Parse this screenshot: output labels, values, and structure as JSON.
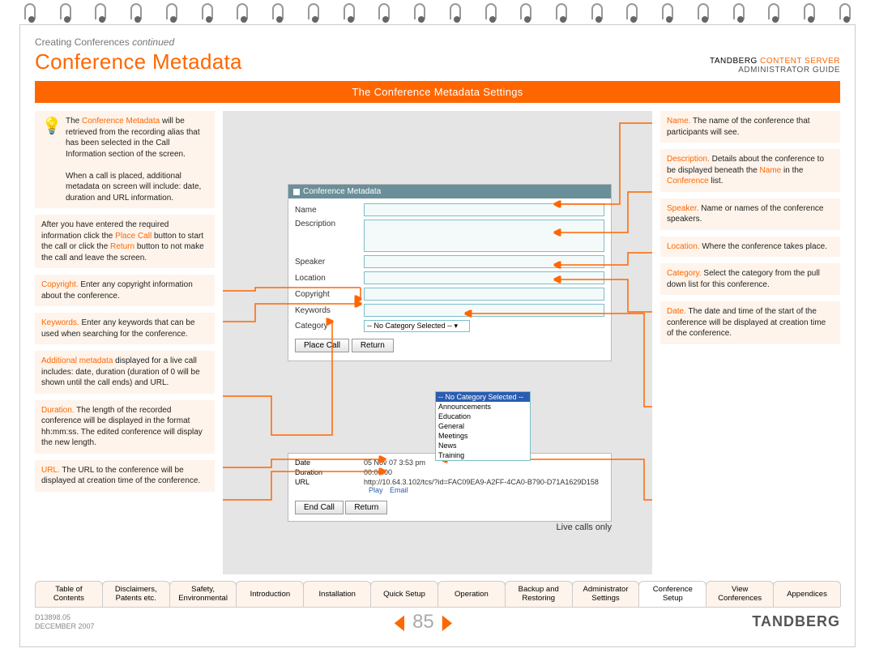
{
  "breadcrumb": {
    "main": "Creating Conferences",
    "sub": "continued"
  },
  "page_title": "Conference Metadata",
  "brand": {
    "name": "TANDBERG",
    "product": "CONTENT SERVER",
    "subtitle": "ADMINISTRATOR GUIDE"
  },
  "banner": "The Conference Metadata Settings",
  "left_cards": [
    {
      "bulb": true,
      "html": "The |Conference Metadata| will be retrieved from the recording alias that has been selected in the Call Information section of the screen.\nWhen a call is placed, additional metadata on screen will include: date, duration and URL information."
    },
    {
      "html": "After you have entered the required information click the |Place Call| button to start the call or click the |Return| button to not make the call and leave the screen."
    },
    {
      "html": "|Copyright.| Enter any copyright information about the conference."
    },
    {
      "html": "|Keywords.| Enter any keywords that can be used when searching for the conference."
    },
    {
      "html": "|Additional metadata| displayed for a live call includes: date, duration (duration of 0 will be shown until the call ends) and URL."
    },
    {
      "html": "|Duration.| The length of the recorded conference will be displayed in the format hh:mm:ss. The edited conference will display the new length."
    },
    {
      "html": "|URL.| The URL to the conference will be displayed at creation time of the conference."
    }
  ],
  "right_cards": [
    {
      "html": "|Name.| The name of the conference that participants will see."
    },
    {
      "html": "|Description.| Details about the conference to be displayed beneath the |Name| in the |Conference| list."
    },
    {
      "html": "|Speaker.| Name or names of the conference speakers."
    },
    {
      "html": "|Location.| Where the conference takes place."
    },
    {
      "html": "|Category.| Select the category from the pull down list for this conference."
    },
    {
      "html": "|Date.| The date and time of the start of the conference will be displayed at creation time of the conference."
    }
  ],
  "form": {
    "title": "Conference Metadata",
    "fields": {
      "name": "Name",
      "description": "Description",
      "speaker": "Speaker",
      "location": "Location",
      "copyright": "Copyright",
      "keywords": "Keywords",
      "category": "Category"
    },
    "category_selected": "-- No Category Selected --",
    "category_options": [
      "-- No Category Selected --",
      "Announcements",
      "Education",
      "General",
      "Meetings",
      "News",
      "Training"
    ],
    "buttons": {
      "place_call": "Place Call",
      "return": "Return",
      "end_call": "End Call"
    }
  },
  "live": {
    "date_label": "Date",
    "date_value": "05 Nov 07 3:53 pm",
    "duration_label": "Duration",
    "duration_value": "00:00:00",
    "url_label": "URL",
    "url_value": "http://10.64.3.102/tcs/?id=FAC09EA9-A2FF-4CA0-B790-D71A1629D158",
    "play": "Play",
    "email": "Email",
    "caption": "Live calls only"
  },
  "nav_tabs": [
    "Table of\nContents",
    "Disclaimers,\nPatents etc.",
    "Safety,\nEnvironmental",
    "Introduction",
    "Installation",
    "Quick Setup",
    "Operation",
    "Backup and\nRestoring",
    "Administrator\nSettings",
    "Conference\nSetup",
    "View\nConferences",
    "Appendices"
  ],
  "nav_active_index": 9,
  "footer": {
    "doc_id": "D13898.05",
    "doc_date": "DECEMBER 2007",
    "page_no": "85",
    "logo": "TANDBERG"
  }
}
